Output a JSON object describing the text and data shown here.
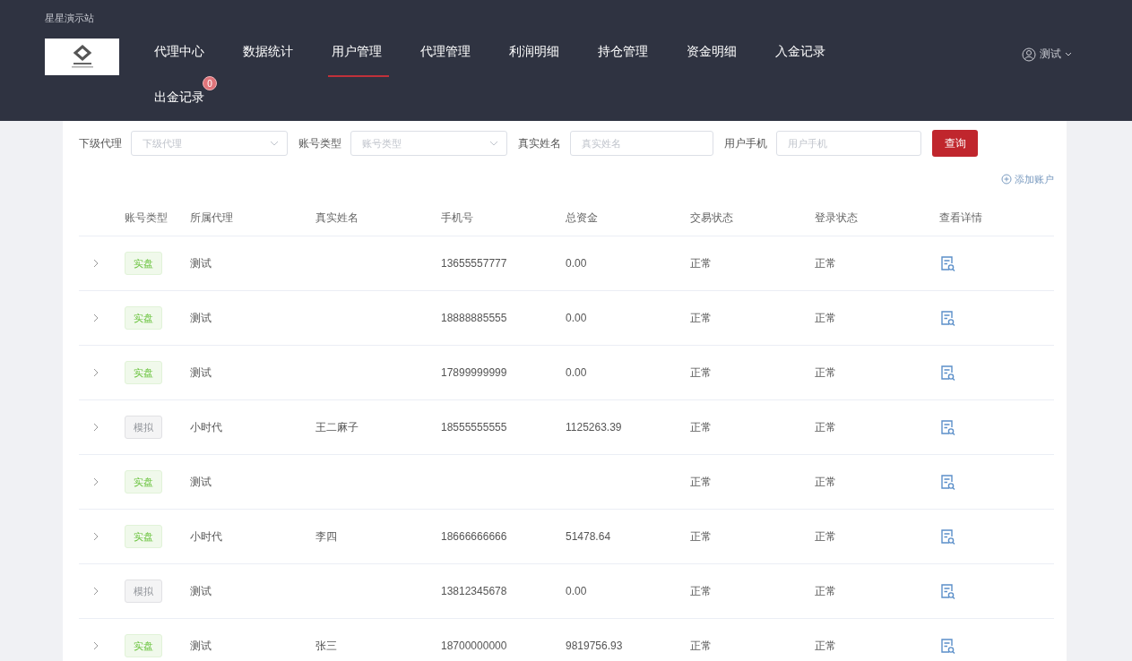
{
  "site_title": "星星演示站",
  "nav": [
    {
      "label": "代理中心",
      "selected": false
    },
    {
      "label": "数据统计",
      "selected": false
    },
    {
      "label": "用户管理",
      "selected": true
    },
    {
      "label": "代理管理",
      "selected": false
    },
    {
      "label": "利润明细",
      "selected": false
    },
    {
      "label": "持仓管理",
      "selected": false
    },
    {
      "label": "资金明细",
      "selected": false
    },
    {
      "label": "入金记录",
      "selected": false
    },
    {
      "label": "出金记录",
      "selected": false,
      "badge": "0"
    }
  ],
  "user": {
    "name": "测试"
  },
  "filters": [
    {
      "label": "下级代理",
      "kind": "select",
      "placeholder": "下级代理"
    },
    {
      "label": "账号类型",
      "kind": "select",
      "placeholder": "账号类型"
    },
    {
      "label": "真实姓名",
      "kind": "text",
      "placeholder": "真实姓名"
    },
    {
      "label": "用户手机",
      "kind": "text",
      "placeholder": "用户手机"
    }
  ],
  "query_button": "查询",
  "add_account": "添加账户",
  "table": {
    "columns": [
      "账号类型",
      "所属代理",
      "真实姓名",
      "手机号",
      "总资金",
      "交易状态",
      "登录状态",
      "查看详情"
    ],
    "rows": [
      {
        "account_type": "实盘",
        "kind": "real",
        "agent": "测试",
        "phone": "13655557777",
        "total_funds": "0.00",
        "trade_status": "正常",
        "login_status": "正常"
      },
      {
        "account_type": "实盘",
        "kind": "real",
        "agent": "测试",
        "phone": "18888885555",
        "total_funds": "0.00",
        "trade_status": "正常",
        "login_status": "正常"
      },
      {
        "account_type": "实盘",
        "kind": "real",
        "agent": "测试",
        "phone": "17899999999",
        "total_funds": "0.00",
        "trade_status": "正常",
        "login_status": "正常"
      },
      {
        "account_type": "模拟",
        "kind": "demo",
        "agent": "小时代",
        "real_name": "王二麻子",
        "phone": "18555555555",
        "total_funds": "1125263.39",
        "trade_status": "正常",
        "login_status": "正常"
      },
      {
        "account_type": "实盘",
        "kind": "real",
        "agent": "测试",
        "trade_status": "正常",
        "login_status": "正常"
      },
      {
        "account_type": "实盘",
        "kind": "real",
        "agent": "小时代",
        "real_name": "李四",
        "phone": "18666666666",
        "total_funds": "51478.64",
        "trade_status": "正常",
        "login_status": "正常"
      },
      {
        "account_type": "模拟",
        "kind": "demo",
        "agent": "测试",
        "phone": "13812345678",
        "total_funds": "0.00",
        "trade_status": "正常",
        "login_status": "正常"
      },
      {
        "account_type": "实盘",
        "kind": "real",
        "agent": "测试",
        "real_name": "张三",
        "phone": "18700000000",
        "total_funds": "9819756.93",
        "trade_status": "正常",
        "login_status": "正常"
      }
    ]
  }
}
